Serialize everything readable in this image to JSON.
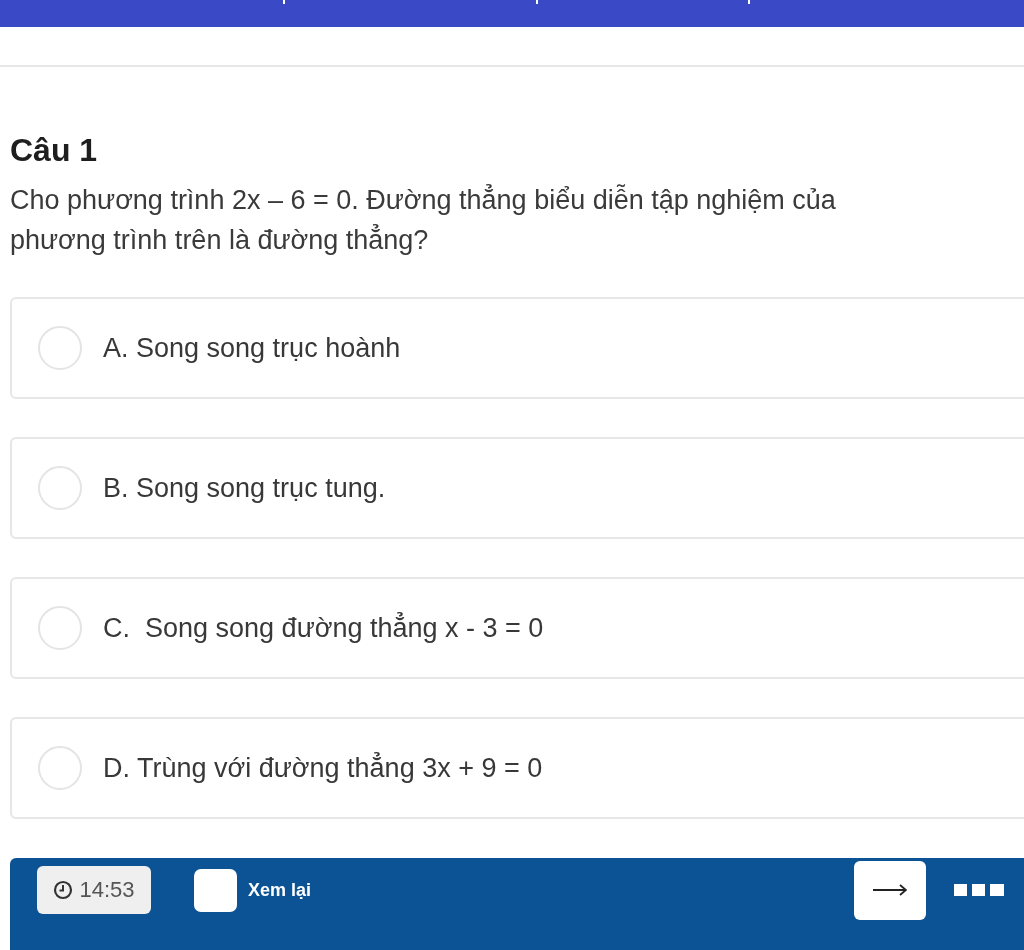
{
  "question": {
    "title": "Câu 1",
    "text": "Cho phương trình 2x – 6 = 0. Đường thẳng biểu diễn tập nghiệm của phương trình trên là đường thẳng?"
  },
  "options": [
    {
      "label": "A. Song song trục hoành",
      "selected": false
    },
    {
      "label": "B. Song song trục tung.",
      "selected": false
    },
    {
      "label": "C.  Song song đường thẳng x - 3 = 0",
      "selected": false
    },
    {
      "label": "D. Trùng với đường thẳng 3x + 9 = 0",
      "selected": false
    }
  ],
  "footer": {
    "timer": "14:53",
    "review": {
      "label": "Xem lại",
      "checked": false
    }
  }
}
